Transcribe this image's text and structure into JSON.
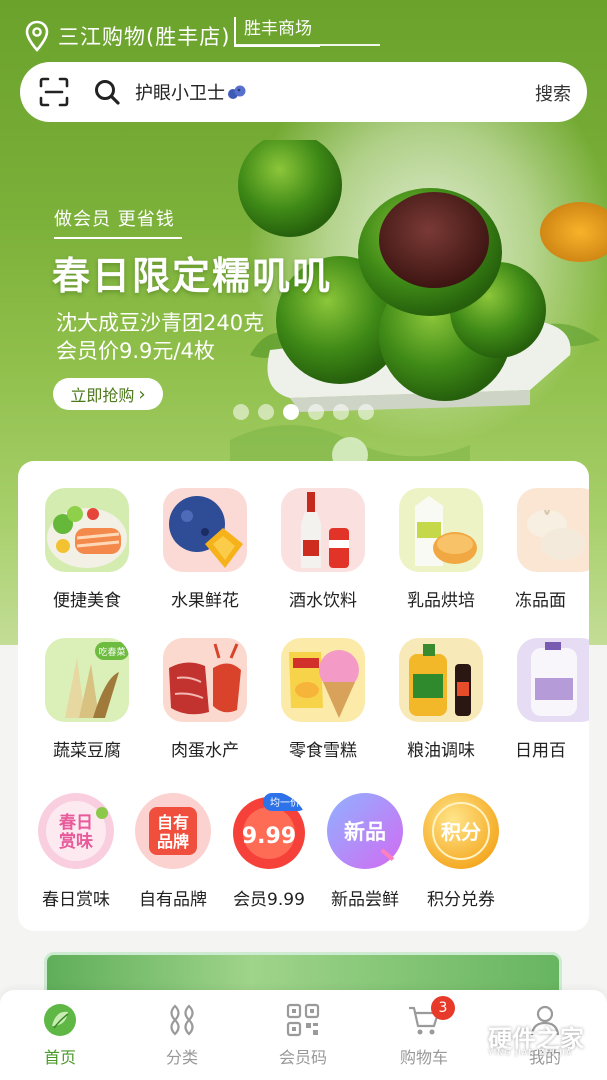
{
  "header": {
    "location_icon": "location-pin-icon",
    "store_name": "三江购物(胜丰店)",
    "mall_tag": "胜丰商场"
  },
  "search": {
    "scan_icon": "scan-icon",
    "search_icon": "search-icon",
    "query": "护眼小卫士",
    "button_label": "搜索"
  },
  "banner": {
    "subtitle": "做会员 更省钱",
    "title": "春日限定糯叽叽",
    "line1": "沈大成豆沙青团240克",
    "line2": "会员价9.9元/4枚",
    "cta_label": "立即抢购",
    "dots_count": 6,
    "active_dot": 2
  },
  "categories": [
    {
      "label": "便捷美食",
      "icon": "convenience-food-icon"
    },
    {
      "label": "水果鲜花",
      "icon": "fruit-flower-icon"
    },
    {
      "label": "酒水饮料",
      "icon": "drinks-icon"
    },
    {
      "label": "乳品烘培",
      "icon": "dairy-bakery-icon"
    },
    {
      "label": "冻品面",
      "icon": "frozen-food-icon"
    },
    {
      "label": "蔬菜豆腐",
      "icon": "vegetable-tofu-icon",
      "badge": "吃春菜"
    },
    {
      "label": "肉蛋水产",
      "icon": "meat-seafood-icon"
    },
    {
      "label": "零食雪糕",
      "icon": "snack-icecream-icon"
    },
    {
      "label": "粮油调味",
      "icon": "grain-oil-icon"
    },
    {
      "label": "日用百",
      "icon": "daily-goods-icon"
    }
  ],
  "featured": [
    {
      "label": "春日赏味",
      "icon": "spring-taste-icon",
      "art_text": "春日赏味"
    },
    {
      "label": "自有品牌",
      "icon": "own-brand-icon",
      "art_text": "自有品牌"
    },
    {
      "label": "会员9.99",
      "icon": "member-999-icon",
      "art_text": "9.99",
      "badge": "均一价"
    },
    {
      "label": "新品尝鲜",
      "icon": "new-product-icon",
      "art_text": "新品"
    },
    {
      "label": "积分兑券",
      "icon": "points-coupon-icon",
      "art_text": "积分"
    }
  ],
  "tabs": [
    {
      "label": "首页",
      "icon": "home-icon",
      "active": true
    },
    {
      "label": "分类",
      "icon": "category-icon",
      "active": false
    },
    {
      "label": "会员码",
      "icon": "member-code-icon",
      "active": false
    },
    {
      "label": "购物车",
      "icon": "cart-icon",
      "active": false,
      "badge": "3"
    },
    {
      "label": "我的",
      "icon": "profile-icon",
      "active": false
    }
  ],
  "watermark": {
    "text": "硬件之家",
    "sub": "YING JIAN ZHI JIA"
  },
  "colors": {
    "brand_green": "#4a9a2a",
    "hero_green": "#7cb13a",
    "badge_red": "#e83a2a"
  }
}
